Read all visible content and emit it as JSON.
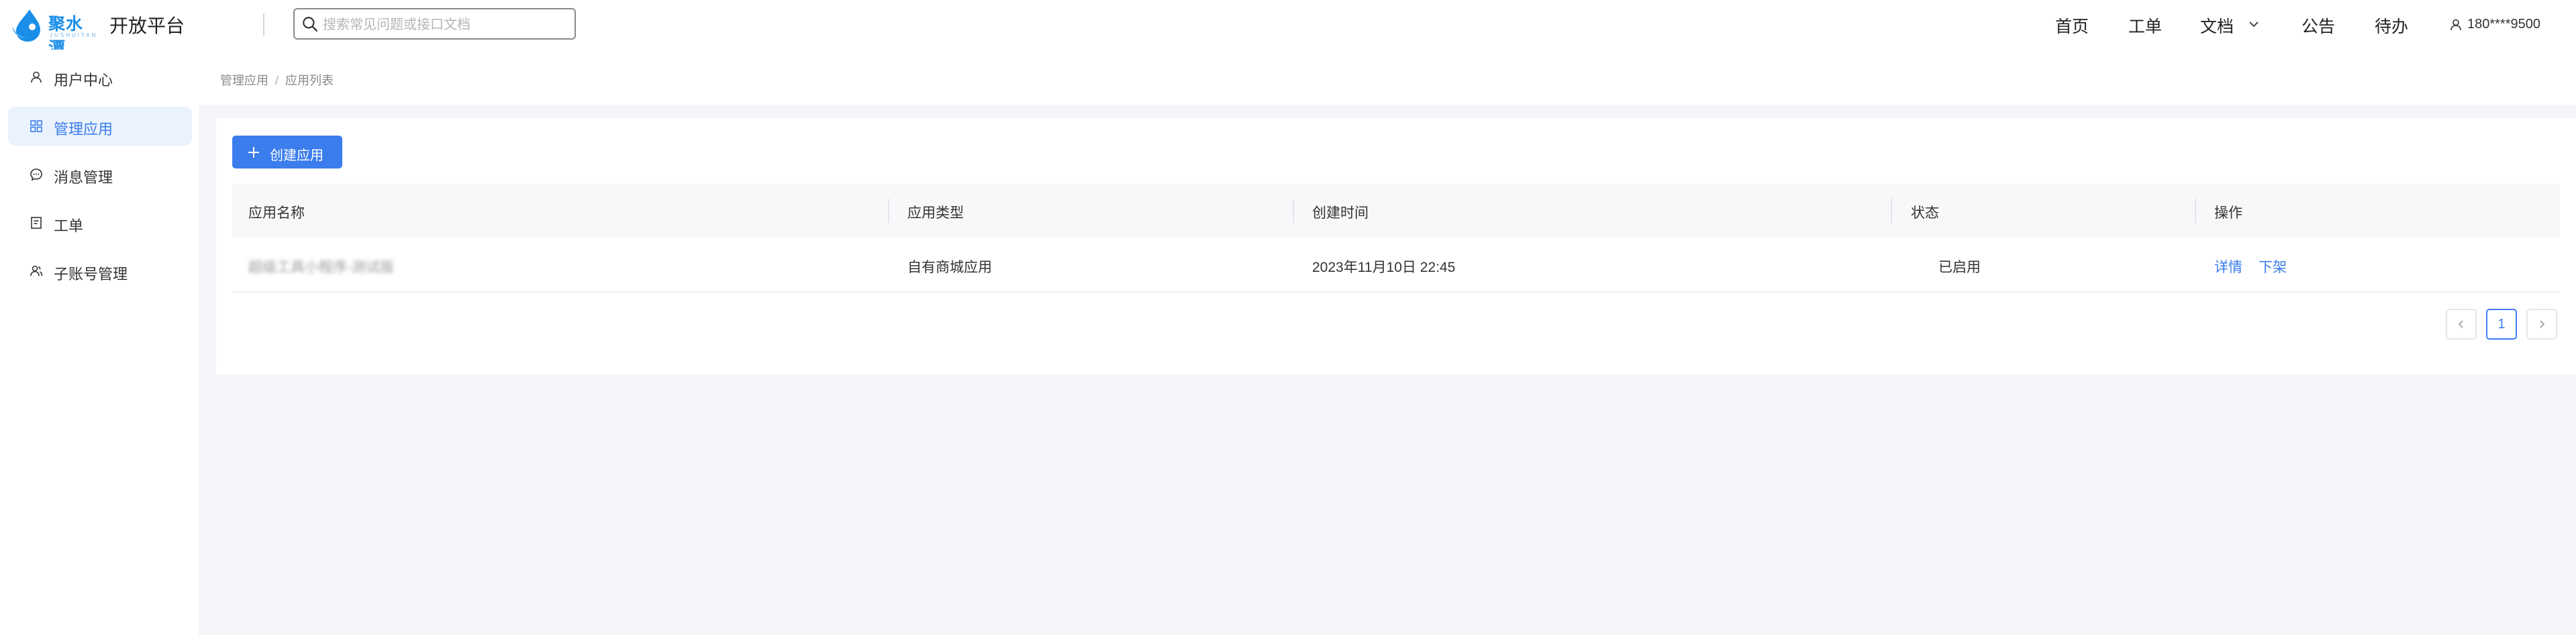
{
  "header": {
    "logo_text": "聚水潭",
    "logo_sub": "JUSHUITAN",
    "app_title": "开放平台",
    "search_placeholder": "搜索常见问题或接口文档",
    "nav": {
      "home": "首页",
      "ticket": "工单",
      "docs": "文档",
      "notice": "公告",
      "todo": "待办"
    },
    "user_phone": "180****9500"
  },
  "sidebar": {
    "items": [
      {
        "label": "用户中心",
        "icon": "user-icon"
      },
      {
        "label": "管理应用",
        "icon": "grid-icon",
        "active": true
      },
      {
        "label": "消息管理",
        "icon": "message-icon"
      },
      {
        "label": "工单",
        "icon": "ticket-icon"
      },
      {
        "label": "子账号管理",
        "icon": "sub-account-icon"
      }
    ]
  },
  "breadcrumb": {
    "parent": "管理应用",
    "separator": "/",
    "current": "应用列表"
  },
  "main": {
    "create_button": "创建应用",
    "table": {
      "columns": [
        "应用名称",
        "应用类型",
        "创建时间",
        "状态",
        "操作"
      ],
      "rows": [
        {
          "name": "超级工具小程序-测试版",
          "type": "自有商城应用",
          "created": "2023年11月10日 22:45",
          "status": "已启用",
          "actions": [
            "详情",
            "下架"
          ]
        }
      ]
    },
    "pagination": {
      "current_page": "1"
    }
  },
  "colors": {
    "accent": "#3b7ded",
    "brand": "#1a8ee8",
    "page_bg": "#f4f6f9"
  }
}
